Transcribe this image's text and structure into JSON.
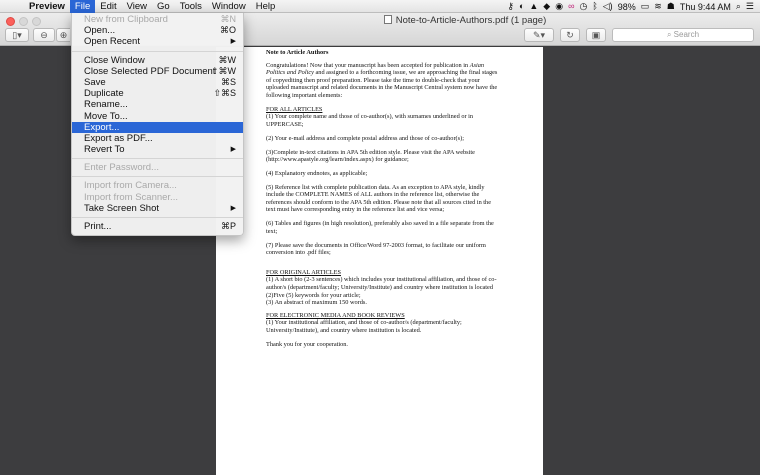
{
  "menubar": {
    "items": [
      "Preview",
      "File",
      "Edit",
      "View",
      "Go",
      "Tools",
      "Window",
      "Help"
    ],
    "battery": "98%",
    "clock": "Thu 9:44 AM"
  },
  "window": {
    "title": "Note-to-Article-Authors.pdf (1 page)",
    "search_placeholder": "Search"
  },
  "file_menu": {
    "new_from_clipboard": "New from Clipboard",
    "new_from_clipboard_sc": "⌘N",
    "open": "Open...",
    "open_sc": "⌘O",
    "open_recent": "Open Recent",
    "close_window": "Close Window",
    "close_window_sc": "⌘W",
    "close_selected": "Close Selected PDF Document",
    "close_selected_sc": "⇧⌘W",
    "save": "Save",
    "save_sc": "⌘S",
    "duplicate": "Duplicate",
    "duplicate_sc": "⇧⌘S",
    "rename": "Rename...",
    "move_to": "Move To...",
    "export": "Export...",
    "export_pdf": "Export as PDF...",
    "revert_to": "Revert To",
    "enter_password": "Enter Password...",
    "import_camera": "Import from Camera...",
    "import_scanner": "Import from Scanner...",
    "take_screenshot": "Take Screen Shot",
    "print": "Print...",
    "print_sc": "⌘P"
  },
  "document": {
    "title": "Note to Article Authors",
    "intro_a": "Congratulations! Now that your manuscript has been accepted for publication in ",
    "intro_journal": "Asian Politics and Policy",
    "intro_b": " and assigned to a forthcoming issue, we are approaching the final stages of copyediting then proof preparation. Please take the time to double-check that your uploaded manuscript and related documents in the Manuscript Central system now have the following important elements:",
    "all_heading": "FOR ALL ARTICLES",
    "p1": "(1) Your complete name and those of co-author(s), with surnames underlined or in UPPERCASE;",
    "p2": "(2) Your e-mail address and complete postal address and those of co-author(s);",
    "p3": "(3)Complete in-text citations in APA 5th edition style.  Please visit the APA website (http://www.apastyle.org/learn/index.aspx) for guidance;",
    "p4": " (4) Explanatory endnotes, as applicable;",
    "p5": " (5) Reference list with complete publication data. As an exception to APA style, kindly include the COMPLETE NAMES of ALL authors in the reference list, otherwise the references should conform to the APA 5th edition. Please note that all sources cited in the text must have corresponding entry in the reference list and vice versa;",
    "p6": " (6) Tables and figures (in high resolution), preferably also saved in a file separate from the text;",
    "p7": "(7) Please save the documents in Office/Word 97-2003 format, to facilitate our uniform conversion into .pdf files;",
    "orig_heading": "FOR ORIGINAL ARTICLES",
    "orig1": "(1) A short bio (2-3 sentences) which includes your institutional affiliation, and those of co-author/s (department/faculty; University/Institute)  and country where institution is located",
    "orig2": "(2)Five (5) keywords for your article;",
    "orig3": "(3) An abstract of maximum 150 words.",
    "media_heading": "FOR ELECTRONIC MEDIA AND BOOK REVIEWS",
    "media1": "(1) Your institutional affiliation, and those of co-author/s (department/faculty; University/Institute), and country where institution is located.",
    "thanks": "Thank you for your cooperation."
  }
}
